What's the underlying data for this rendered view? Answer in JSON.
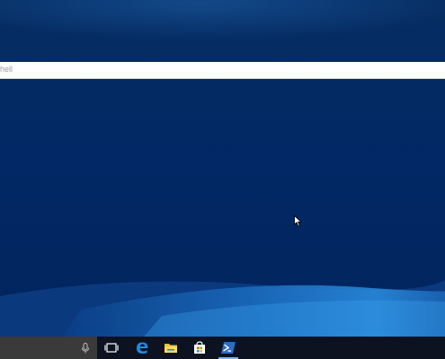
{
  "desktop": {
    "background_color": "#012a66"
  },
  "search": {
    "query_text": "hell"
  },
  "taskbar": {
    "background_color": "#0c1220",
    "search_box_color": "#3a3a3a",
    "icons": [
      {
        "name": "microphone-icon"
      },
      {
        "name": "task-view-icon"
      },
      {
        "name": "edge-icon"
      },
      {
        "name": "file-explorer-icon"
      },
      {
        "name": "store-icon"
      },
      {
        "name": "powershell-icon"
      }
    ]
  }
}
